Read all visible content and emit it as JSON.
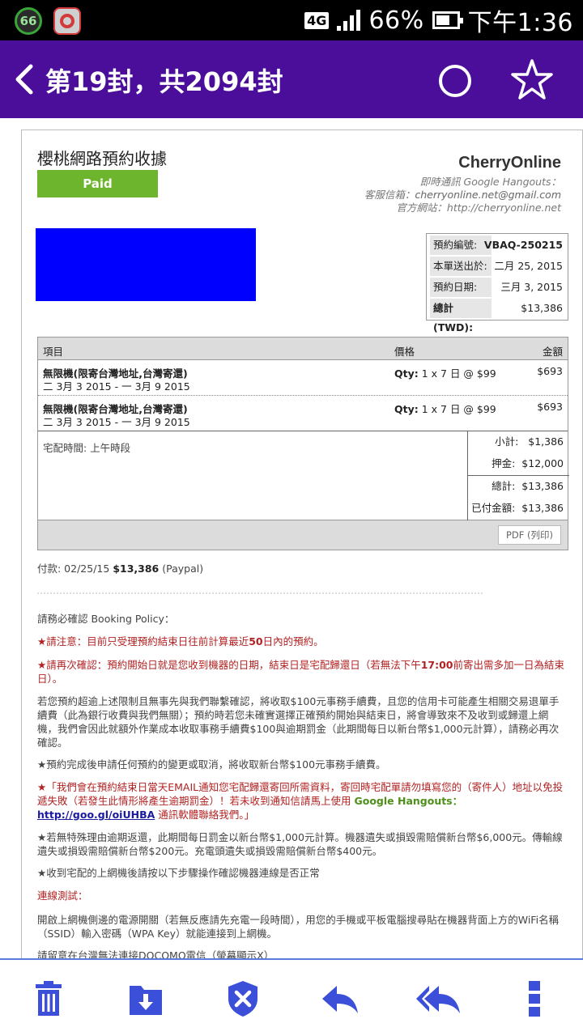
{
  "status_bar": {
    "badge_number": "66",
    "network": "4G",
    "battery": "66%",
    "time": "下午1:36"
  },
  "app_bar": {
    "title": "第19封，共2094封"
  },
  "receipt": {
    "title": "櫻桃網路預約收據",
    "paid_label": "Paid",
    "brand": "CherryOnline",
    "contact_lines": [
      "即時通訊 Google Hangouts：cherryonline.net@gmail.com",
      "客服信箱：cherryonline.net@gmail.com",
      "官方網站：http://cherryonline.net"
    ],
    "info": [
      {
        "label": "預約編號:",
        "value": "VBAQ-250215"
      },
      {
        "label": "本單送出於:",
        "value": "二月 25, 2015"
      },
      {
        "label": "預約日期:",
        "value": "三月 3, 2015"
      },
      {
        "label": "總計 (TWD):",
        "value": "$13,386"
      }
    ],
    "table_headers": {
      "item": "項目",
      "price": "價格",
      "amount": "金額"
    },
    "items": [
      {
        "name": "無限機(限寄台灣地址,台灣寄還)",
        "dates": "二 3月 3 2015 - 一 3月 9 2015",
        "qty_label": "Qty:",
        "qty": "1 x 7 日 @ $99",
        "amount": "$693"
      },
      {
        "name": "無限機(限寄台灣地址,台灣寄還)",
        "dates": "二 3月 3 2015 - 一 3月 9 2015",
        "qty_label": "Qty:",
        "qty": "1 x 7 日 @ $99",
        "amount": "$693"
      }
    ],
    "delivery_time": "宅配時間: 上午時段",
    "totals": [
      {
        "label": "小計:",
        "value": "$1,386"
      },
      {
        "label": "押金:",
        "value": "$12,000"
      },
      {
        "label": "總計:",
        "value": "$13,386"
      },
      {
        "label": "已付金額:",
        "value": "$13,386"
      }
    ],
    "pdf_button": "PDF (列印)",
    "payment": {
      "prefix": "付款: 02/25/15",
      "amount": "$13,386",
      "method": "(Paypal)"
    }
  },
  "policy": {
    "heading": "請務必確認 Booking Policy：",
    "p1_a": "★請注意：目前只受理預約結束日往前計算最近",
    "p1_b": "50",
    "p1_c": "日內的預約。",
    "p2_a": "★請再次確認：預約開始日就是您收到機器的日期，結束日是宅配歸還日（若無法下午",
    "p2_b": "17:00",
    "p2_c": "前寄出需多加一日為結束日）。",
    "p3": "若您預約超逾上述限制且無事先與我們聯繫確認，將收取$100元事務手續費，且您的信用卡可能產生相關交易退單手續費（此為銀行收費與我們無關）；預約時若您未確實選擇正確預約開始與結束日，將會導致來不及收到或歸還上網機，我們會因此就額外作業成本收取事務手續費$100與逾期罰金（此期間每日以新台幣$1,000元計算），請務必再次確認。",
    "p4": "★預約完成後申請任何預約的變更或取消，將收取新台幣$100元事務手續費。",
    "p5_a": "★「我們會在預約結束日當天EMAIL通知您宅配歸還寄回所需資料，寄回時宅配單請勿填寫您的（寄件人）地址以免投遞失敗（若發生此情形將產生逾期罰金）！若未收到通知信請馬上使用 ",
    "p5_google": "Google Hangouts",
    "p5_sep": "：",
    "p5_link": "http://goo.gl/oiUHBA",
    "p5_b": " 通訊軟體聯絡我們。」",
    "p6": "★若無特殊理由逾期返還，此期間每日罰金以新台幣$1,000元計算。機器遺失或損毀需賠償新台幣$6,000元。傳輸線遺失或損毀需賠償新台幣$200元。充電頭遺失或損毀需賠償新台幣$400元。",
    "p7": "★收到宅配的上網機後請按以下步驟操作確認機器連線是否正常",
    "p8": "連線測試：",
    "p9": "開啟上網機側邊的電源開關（若無反應請先充電一段時間），用您的手機或平板電腦搜尋貼在機器背面上方的WiFi名稱（SSID）輸入密碼（WPA Key）就能連接到上網機。",
    "p10": "請留意在台灣無法連接DOCOMO電信（螢幕顯示X）"
  },
  "colors": {
    "app_bar": "#4a0e9a",
    "paid": "#6cb52d",
    "action_icons": "#3b4fd8"
  },
  "bottom_actions": [
    "trash-icon",
    "archive-icon",
    "spam-shield-icon",
    "reply-icon",
    "reply-all-icon",
    "more-vert-icon"
  ]
}
